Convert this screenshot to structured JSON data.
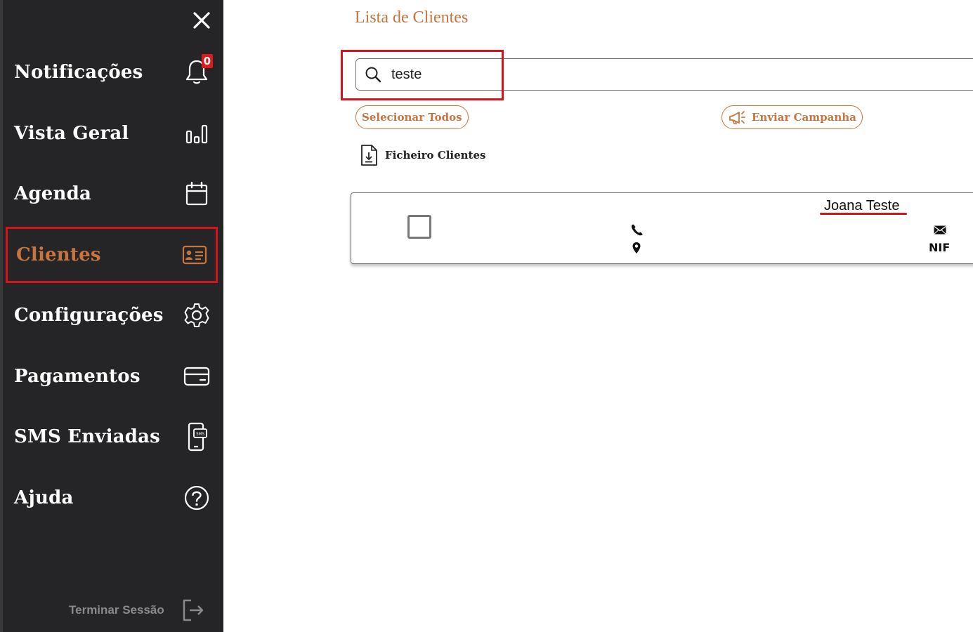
{
  "sidebar": {
    "notifications_badge": "0",
    "items": [
      {
        "label": "Notificações",
        "icon": "bell-icon"
      },
      {
        "label": "Vista Geral",
        "icon": "bar-chart-icon"
      },
      {
        "label": "Agenda",
        "icon": "calendar-icon"
      },
      {
        "label": "Clientes",
        "icon": "id-card-icon",
        "active": true
      },
      {
        "label": "Configurações",
        "icon": "gear-icon"
      },
      {
        "label": "Pagamentos",
        "icon": "credit-card-icon"
      },
      {
        "label": "SMS Enviadas",
        "icon": "sms-phone-icon"
      },
      {
        "label": "Ajuda",
        "icon": "help-circle-icon"
      }
    ],
    "logout_label": "Terminar Sessão"
  },
  "main": {
    "title": "Lista de Clientes",
    "search": {
      "value": "teste"
    },
    "select_all_label": "Selecionar Todos",
    "send_campaign_label": "Enviar Campanha",
    "client_file_label": "Ficheiro Clientes",
    "clients": [
      {
        "name": "Joana Teste",
        "nif_label": "NIF"
      }
    ]
  },
  "colors": {
    "accent": "#c8743f",
    "sidebar_bg": "#252527",
    "highlight": "#d3141b"
  }
}
